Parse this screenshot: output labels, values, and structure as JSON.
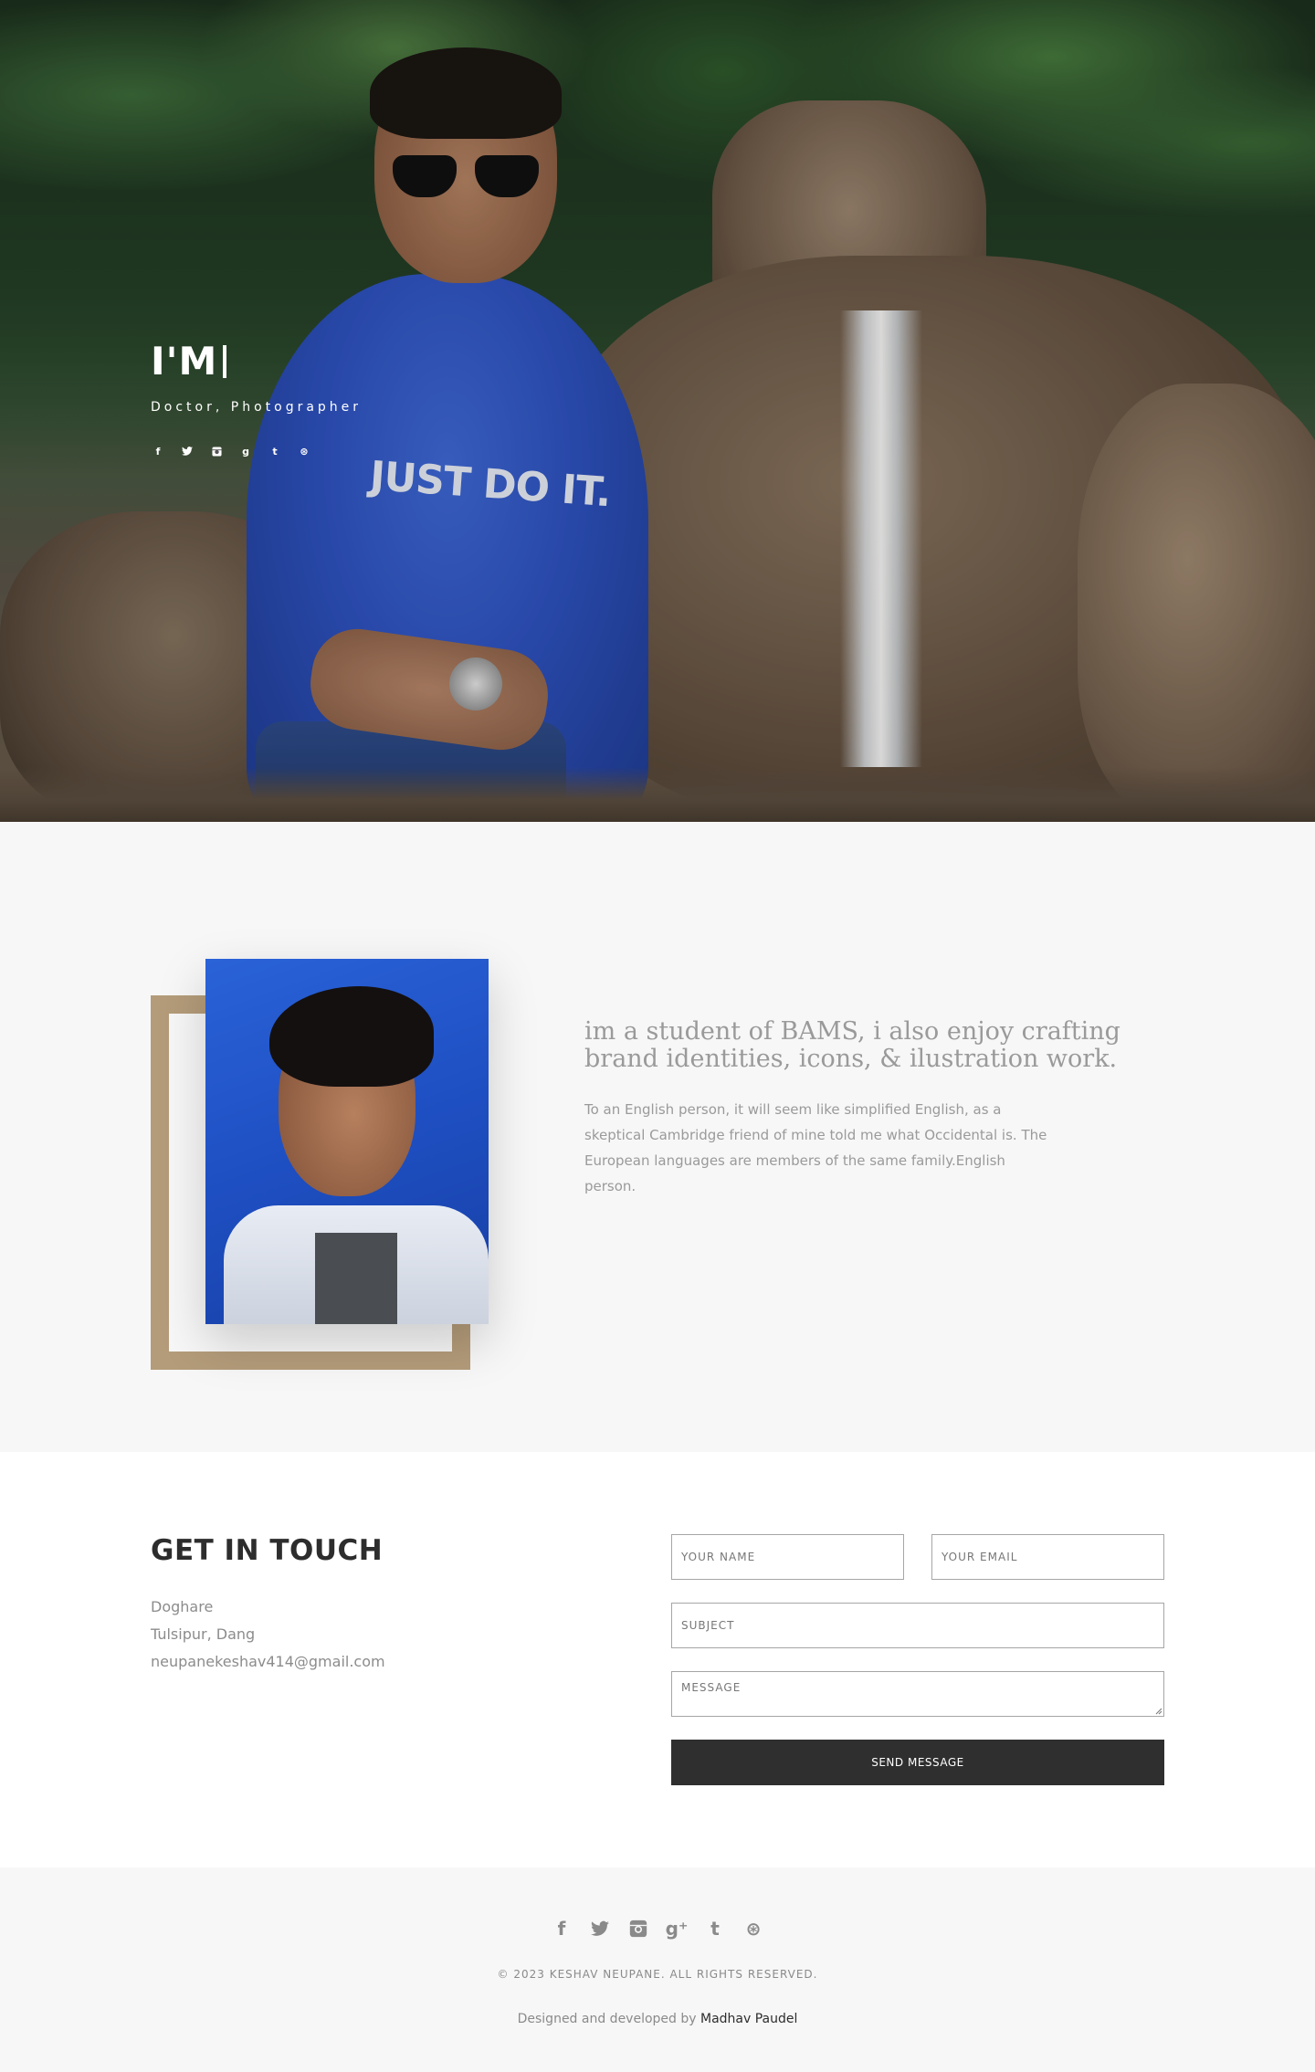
{
  "hero": {
    "title": "I'M",
    "subtitle": "Doctor, Photographer",
    "shirt_text": "JUST DO IT.",
    "social": [
      {
        "icon": "facebook-icon",
        "glyph": "f"
      },
      {
        "icon": "twitter-icon",
        "glyph": "🐦"
      },
      {
        "icon": "instagram-icon",
        "glyph": "◙"
      },
      {
        "icon": "google-plus-icon",
        "glyph": "g"
      },
      {
        "icon": "tumblr-icon",
        "glyph": "t"
      },
      {
        "icon": "dribbble-icon",
        "glyph": "⊛"
      }
    ]
  },
  "about": {
    "heading": "im a student of BAMS, i also enjoy crafting brand identities, icons, & ilustration work.",
    "body": "To an English person, it will seem like simplified English, as a skeptical Cambridge friend of mine told me what Occidental is. The European languages are members of the same family.English person.",
    "frame_color": "#b49c7a"
  },
  "contact": {
    "title": "GET IN TOUCH",
    "address_line1": "Doghare",
    "address_line2": "Tulsipur, Dang",
    "email": "neupanekeshav414@gmail.com",
    "form": {
      "name_placeholder": "YOUR NAME",
      "email_placeholder": "YOUR EMAIL",
      "subject_placeholder": "SUBJECT",
      "message_placeholder": "MESSAGE",
      "send_label": "SEND MESSAGE"
    }
  },
  "footer": {
    "social": [
      {
        "icon": "facebook-icon",
        "glyph": "f"
      },
      {
        "icon": "twitter-icon",
        "glyph": "🐦"
      },
      {
        "icon": "instagram-icon",
        "glyph": "◙"
      },
      {
        "icon": "google-plus-icon",
        "glyph": "g⁺"
      },
      {
        "icon": "tumblr-icon",
        "glyph": "t"
      },
      {
        "icon": "dribbble-icon",
        "glyph": "⊛"
      }
    ],
    "copyright": "© 2023 KESHAV NEUPANE. ALL RIGHTS RESERVED.",
    "credit_prefix": "Designed and developed by ",
    "credit_author": "Madhav Paudel"
  },
  "colors": {
    "accent_frame": "#b49c7a",
    "button_bg": "#2f2f2f",
    "heading_dark": "#2d2d2d",
    "muted_text": "#9a9a9a"
  }
}
